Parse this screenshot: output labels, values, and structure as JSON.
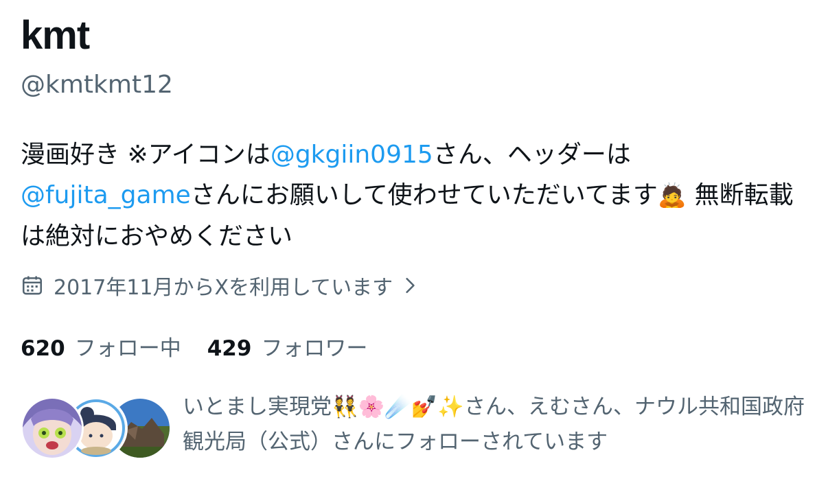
{
  "profile": {
    "display_name": "kmt",
    "handle": "@kmtkmt12",
    "bio": {
      "part1": "漫画好き ※アイコンは",
      "mention1": "@gkgiin0915",
      "part2": "さん、ヘッダーは",
      "mention2": "@fujita_game",
      "part3": "さんにお願いして使わせていただいてます",
      "emoji": "🙇",
      "part4": "無断転載は絶対におやめください"
    },
    "joined": "2017年11月からXを利用しています",
    "stats": {
      "following_count": "620",
      "following_label": "フォロー中",
      "followers_count": "429",
      "followers_label": "フォロワー"
    },
    "followed_by": {
      "text": "いとまし実現党👯🌸☄️💅✨さん、えむさん、ナウル共和国政府観光局（公式）さんにフォローされています"
    }
  },
  "colors": {
    "text_primary": "#0f1419",
    "text_secondary": "#536471",
    "link": "#1d9bf0"
  },
  "icons": {
    "joined": "calendar-icon",
    "chevron": "chevron-right-icon"
  }
}
